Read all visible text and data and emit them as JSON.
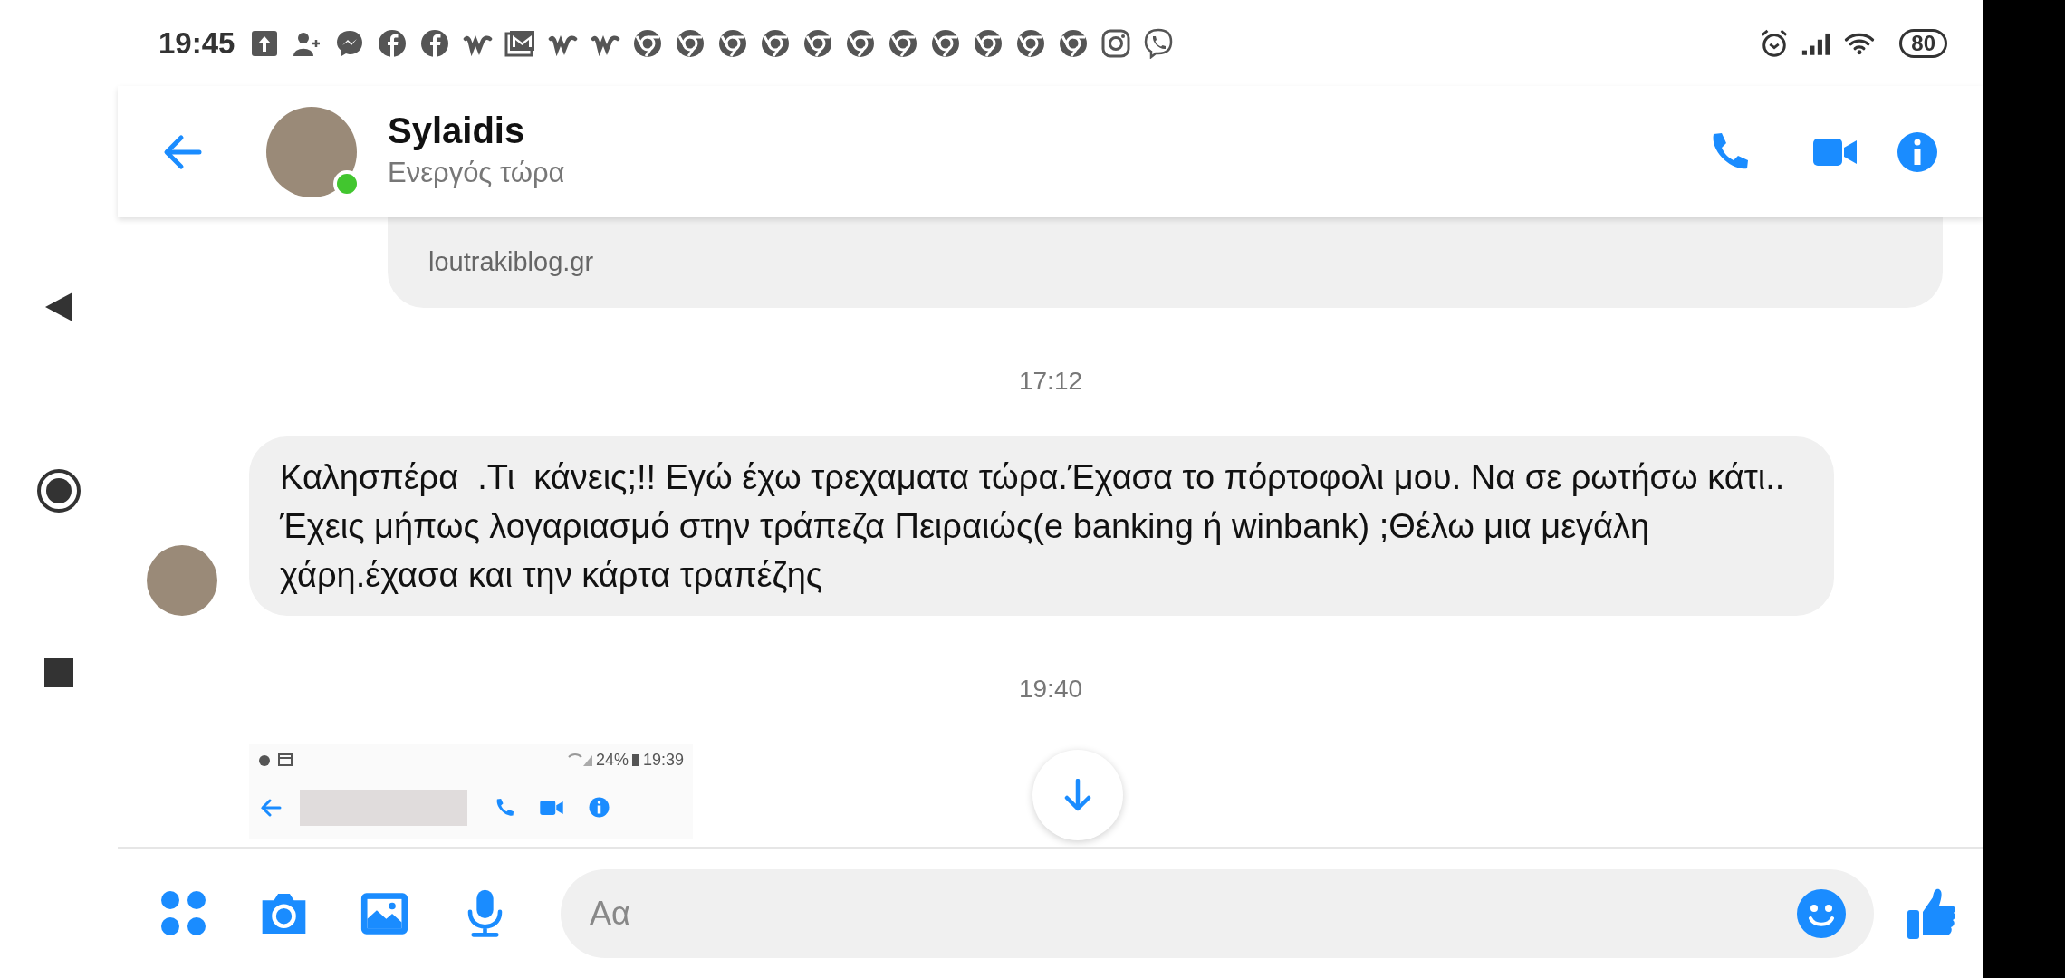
{
  "status_bar": {
    "time": "19:45",
    "battery": "80"
  },
  "header": {
    "name": "Sylaidis",
    "status": "Ενεργός τώρα",
    "online": true
  },
  "messages": [
    {
      "kind": "link_preview",
      "domain": "loutrakiblog.gr"
    },
    {
      "kind": "timestamp",
      "text": "17:12"
    },
    {
      "kind": "incoming",
      "text": "Καλησπέρα  .Τι  κάνεις;!! Εγώ έχω τρεχαματα τώρα.Έχασα το πόρτοφολι μου. Να σε ρωτήσω κάτι.. Έχεις μήπως λογαριασμό στην τράπεζα Πειραιώς(e banking ή winbank) ;Θέλω μια μεγάλη χάρη.έχασα και την κάρτα τραπέζης"
    },
    {
      "kind": "timestamp",
      "text": "19:40"
    },
    {
      "kind": "image",
      "battery": "24%",
      "time": "19:39"
    }
  ],
  "composer": {
    "placeholder": "Αα"
  }
}
